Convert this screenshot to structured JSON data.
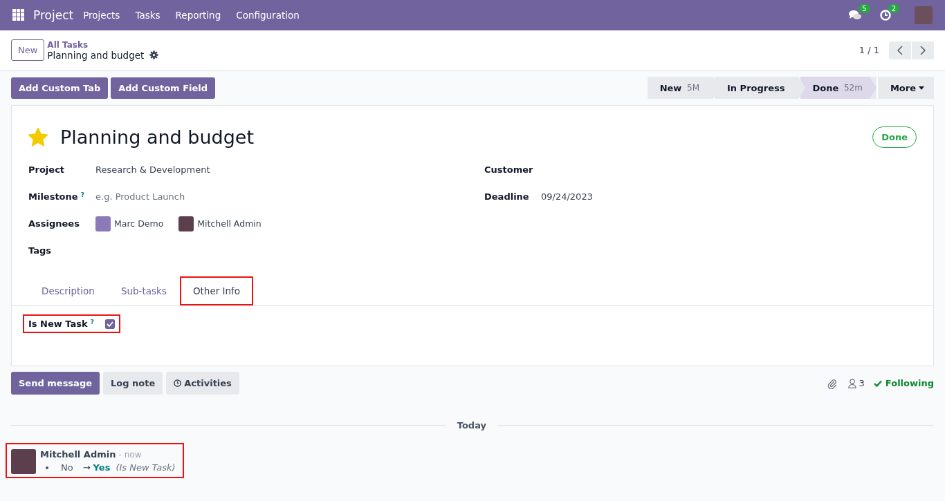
{
  "navbar": {
    "app": "Project",
    "menu": [
      "Projects",
      "Tasks",
      "Reporting",
      "Configuration"
    ],
    "messages_badge": "5",
    "activities_badge": "2"
  },
  "control_panel": {
    "new_button": "New",
    "breadcrumb": "All Tasks",
    "record": "Planning and budget",
    "pager": "1 / 1"
  },
  "header_buttons": [
    "Add Custom Tab",
    "Add Custom Field"
  ],
  "stages": [
    {
      "label": "New",
      "duration": "5M",
      "selected": false
    },
    {
      "label": "In Progress",
      "selected": false
    },
    {
      "label": "Done",
      "duration": "52m",
      "selected": true
    }
  ],
  "more_button": "More",
  "form": {
    "starred": true,
    "title": "Planning and budget",
    "status": "Done",
    "left_fields": [
      {
        "kind": "text",
        "label": "Project",
        "value": "Research & Development"
      },
      {
        "kind": "placeholder",
        "label": "Milestone",
        "help": "?",
        "placeholder": "e.g. Product Launch"
      },
      {
        "kind": "people",
        "label": "Assignees",
        "people": [
          "Marc Demo",
          "Mitchell Admin"
        ]
      },
      {
        "kind": "empty",
        "label": "Tags"
      }
    ],
    "right_fields": [
      {
        "kind": "empty",
        "label": "Customer"
      },
      {
        "kind": "text",
        "label": "Deadline",
        "value": "09/24/2023"
      }
    ],
    "tabs": [
      {
        "label": "Description",
        "selected": false,
        "highlighted": false
      },
      {
        "label": "Sub-tasks",
        "selected": false,
        "highlighted": false
      },
      {
        "label": "Other Info",
        "selected": true,
        "highlighted": true
      }
    ],
    "tab_fields": [
      {
        "label": "Is New Task",
        "help": "?",
        "checked": true,
        "highlighted": true
      }
    ]
  },
  "chatter": {
    "buttons": [
      {
        "label": "Send message",
        "kind": "primary"
      },
      {
        "label": "Log note",
        "kind": "secondary"
      },
      {
        "label": "Activities",
        "kind": "activities"
      }
    ],
    "followers": "3",
    "following": "Following",
    "date_separator": "Today",
    "messages": [
      {
        "author": "Mitchell Admin",
        "time": "- now",
        "old": "No",
        "arrow": "→",
        "new": "Yes",
        "field": "(Is New Task)",
        "highlighted": true
      }
    ]
  }
}
